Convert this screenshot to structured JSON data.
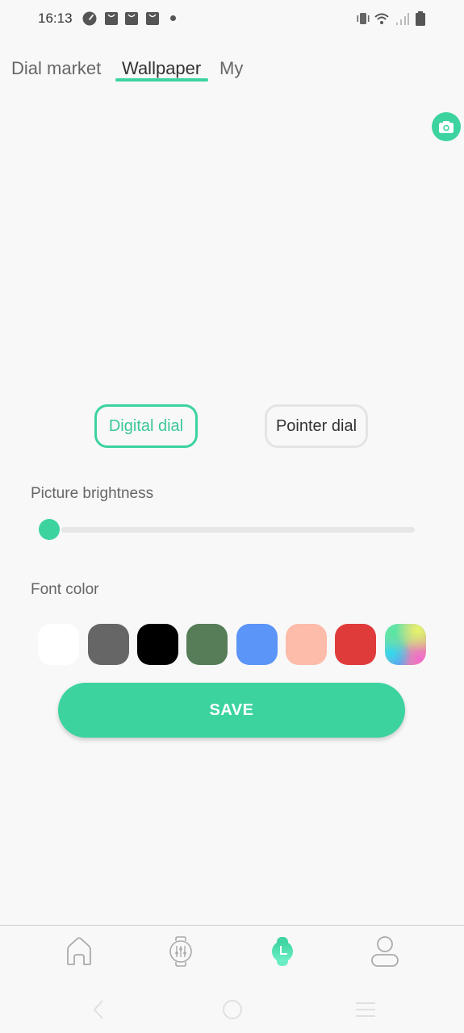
{
  "status_bar": {
    "time": "16:13",
    "left_icons": [
      "speedometer-icon",
      "shopping-bag-icon",
      "shopping-bag-icon",
      "shopping-bag-icon",
      "dot-icon"
    ],
    "right_icons": [
      "vibrate-icon",
      "wifi-icon",
      "signal-icon",
      "battery-icon"
    ]
  },
  "tabs": [
    {
      "label": "Dial market",
      "active": false
    },
    {
      "label": "Wallpaper",
      "active": true
    },
    {
      "label": "My",
      "active": false
    }
  ],
  "camera_button": {
    "icon": "camera-icon"
  },
  "dial_types": {
    "digital": {
      "label": "Digital dial",
      "selected": true
    },
    "pointer": {
      "label": "Pointer dial",
      "selected": false
    }
  },
  "brightness": {
    "label": "Picture brightness",
    "value_percent": 0
  },
  "font_color": {
    "label": "Font color",
    "swatches": [
      {
        "name": "white",
        "color": "#ffffff"
      },
      {
        "name": "gray",
        "color": "#666666"
      },
      {
        "name": "black",
        "color": "#000000"
      },
      {
        "name": "green",
        "color": "#567d58"
      },
      {
        "name": "blue",
        "color": "#5b95f7"
      },
      {
        "name": "peach",
        "color": "#fdbba9"
      },
      {
        "name": "red",
        "color": "#e03b3b"
      },
      {
        "name": "rainbow",
        "color": "gradient"
      }
    ]
  },
  "save_button": {
    "label": "SAVE"
  },
  "bottom_nav": [
    {
      "name": "home",
      "icon": "home-icon",
      "active": false
    },
    {
      "name": "device-settings",
      "icon": "watch-sliders-icon",
      "active": false
    },
    {
      "name": "dial",
      "icon": "watch-clock-icon",
      "active": true
    },
    {
      "name": "profile",
      "icon": "user-icon",
      "active": false
    }
  ],
  "system_nav": [
    "back-icon",
    "home-circle-icon",
    "menu-icon"
  ],
  "colors": {
    "accent": "#3cd39f",
    "background": "#f8f8f8",
    "text_primary": "#333333",
    "text_secondary": "#666666"
  }
}
